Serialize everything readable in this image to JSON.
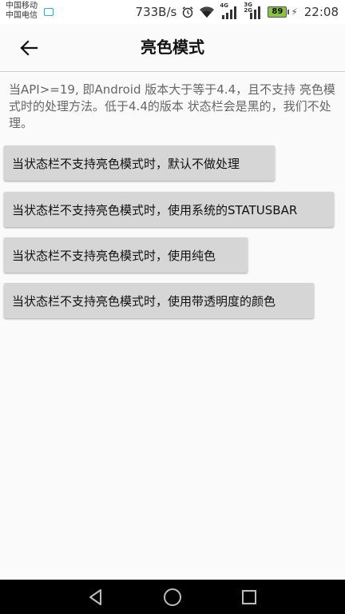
{
  "status_bar": {
    "carrier1": "中国移动",
    "carrier2": "中国电信",
    "net_speed": "733B/s",
    "signal1_type": "4G",
    "signal2_type": "3G 2G",
    "battery": "89",
    "time": "22:08",
    "icons": [
      "sim-icon",
      "alarm-icon",
      "wifi-icon",
      "signal-icon",
      "battery-icon",
      "charging-icon"
    ]
  },
  "toolbar": {
    "title": "亮色模式",
    "back_icon": "arrow-left-icon"
  },
  "content": {
    "description": "当API>=19, 即Android 版本大于等于4.4，且不支持 亮色模式时的处理方法。低于4.4的版本 状态栏会是黑的，我们不处理。",
    "buttons": [
      {
        "label": "当状态栏不支持亮色模式时，默认不做处理"
      },
      {
        "label": "当状态栏不支持亮色模式时，使用系统的STATUSBAR"
      },
      {
        "label": "当状态栏不支持亮色模式时，使用纯色"
      },
      {
        "label": "当状态栏不支持亮色模式时，使用带透明度的颜色"
      }
    ]
  },
  "nav_bar": {
    "icons": [
      "back-triangle-icon",
      "home-circle-icon",
      "recents-square-icon"
    ]
  },
  "colors": {
    "background": "#fafafa",
    "button": "#d6d6d6",
    "navbar": "#000000",
    "battery": "#8bc34a",
    "sim_icon": "#2aa9c9"
  }
}
